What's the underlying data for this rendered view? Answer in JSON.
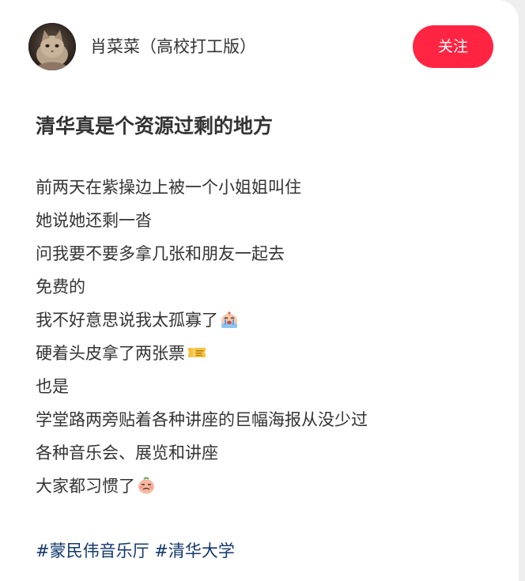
{
  "author": {
    "name": "肖菜菜（高校打工版）",
    "avatar_icon": "cat-photo-avatar",
    "follow_label": "关注",
    "follow_color": "#ff2442"
  },
  "post": {
    "title": "清华真是个资源过剩的地方",
    "lines": [
      {
        "text": "前两天在紫操边上被一个小姐姐叫住",
        "emoji": ""
      },
      {
        "text": "她说她还剩一沓",
        "emoji": ""
      },
      {
        "text": "问我要不要多拿几张和朋友一起去",
        "emoji": ""
      },
      {
        "text": "免费的",
        "emoji": ""
      },
      {
        "text": "我不好意思说我太孤寡了",
        "emoji": "crying-face-emoji"
      },
      {
        "text": "硬着头皮拿了两张票",
        "emoji": "ticket-emoji"
      },
      {
        "text": "也是",
        "emoji": ""
      },
      {
        "text": "学堂路两旁贴着各种讲座的巨幅海报从没少过",
        "emoji": ""
      },
      {
        "text": "各种音乐会、展览和讲座",
        "emoji": ""
      },
      {
        "text": "大家都习惯了",
        "emoji": "shrugging-face-emoji"
      }
    ],
    "hashtags": [
      "#蒙民伟音乐厅",
      "#清华大学"
    ],
    "hashtag_color": "#13386c"
  }
}
